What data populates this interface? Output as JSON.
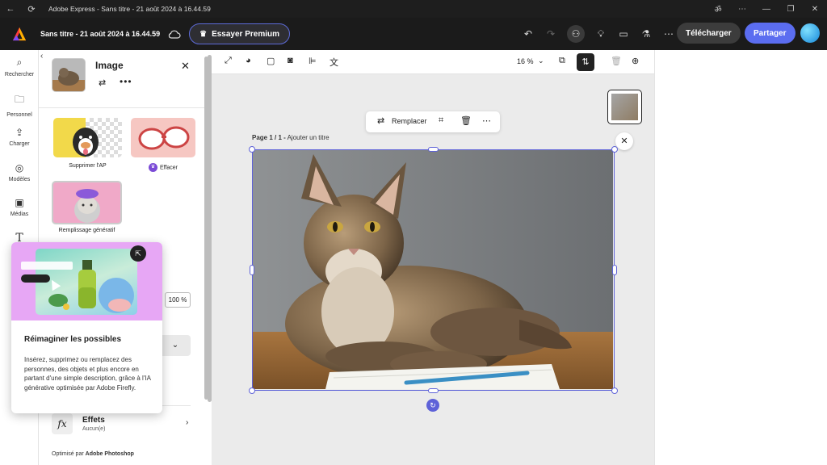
{
  "titlebar": {
    "app_title": "Adobe Express - Sans titre - 21 août 2024 à 16.44.59",
    "translate_glyph": "ॐ"
  },
  "header": {
    "doc_title": "Sans titre - 21 août 2024 à 16.44.59",
    "premium_label": "Essayer Premium",
    "download_label": "Télécharger",
    "share_label": "Partager"
  },
  "rail": {
    "items": [
      {
        "label": "Rechercher",
        "icon": "search-icon"
      },
      {
        "label": "Personnel",
        "icon": "folder-icon"
      },
      {
        "label": "Charger",
        "icon": "upload-icon"
      },
      {
        "label": "Modèles",
        "icon": "templates-icon"
      },
      {
        "label": "Médias",
        "icon": "media-icon"
      },
      {
        "label": "T",
        "icon": "text-icon"
      }
    ]
  },
  "panel": {
    "title": "Image",
    "tools": {
      "remove_bg": "Supprimer l'AP",
      "erase": "Effacer",
      "generative_fill": "Remplissage génératif"
    },
    "opacity_value": "100 %",
    "effects_title": "Effets",
    "effects_value": "Aucun(e)",
    "powered_prefix": "Optimisé par",
    "powered_brand": "Adobe Photoshop"
  },
  "promo": {
    "title": "Réimaginer les possibles",
    "body": "Insérez, supprimez ou remplacez des personnes, des objets et plus encore en partant d'une simple description, grâce à l'IA générative optimisée par Adobe Firefly."
  },
  "canvas": {
    "zoom": "16 %",
    "page_label_bold": "Page 1 / 1 -",
    "page_label_rest": "Ajouter un titre",
    "ctx_replace": "Remplacer"
  },
  "colors": {
    "accent": "#5b6df0",
    "selection": "#5e62d8",
    "premium_border": "#5d6bd8"
  }
}
